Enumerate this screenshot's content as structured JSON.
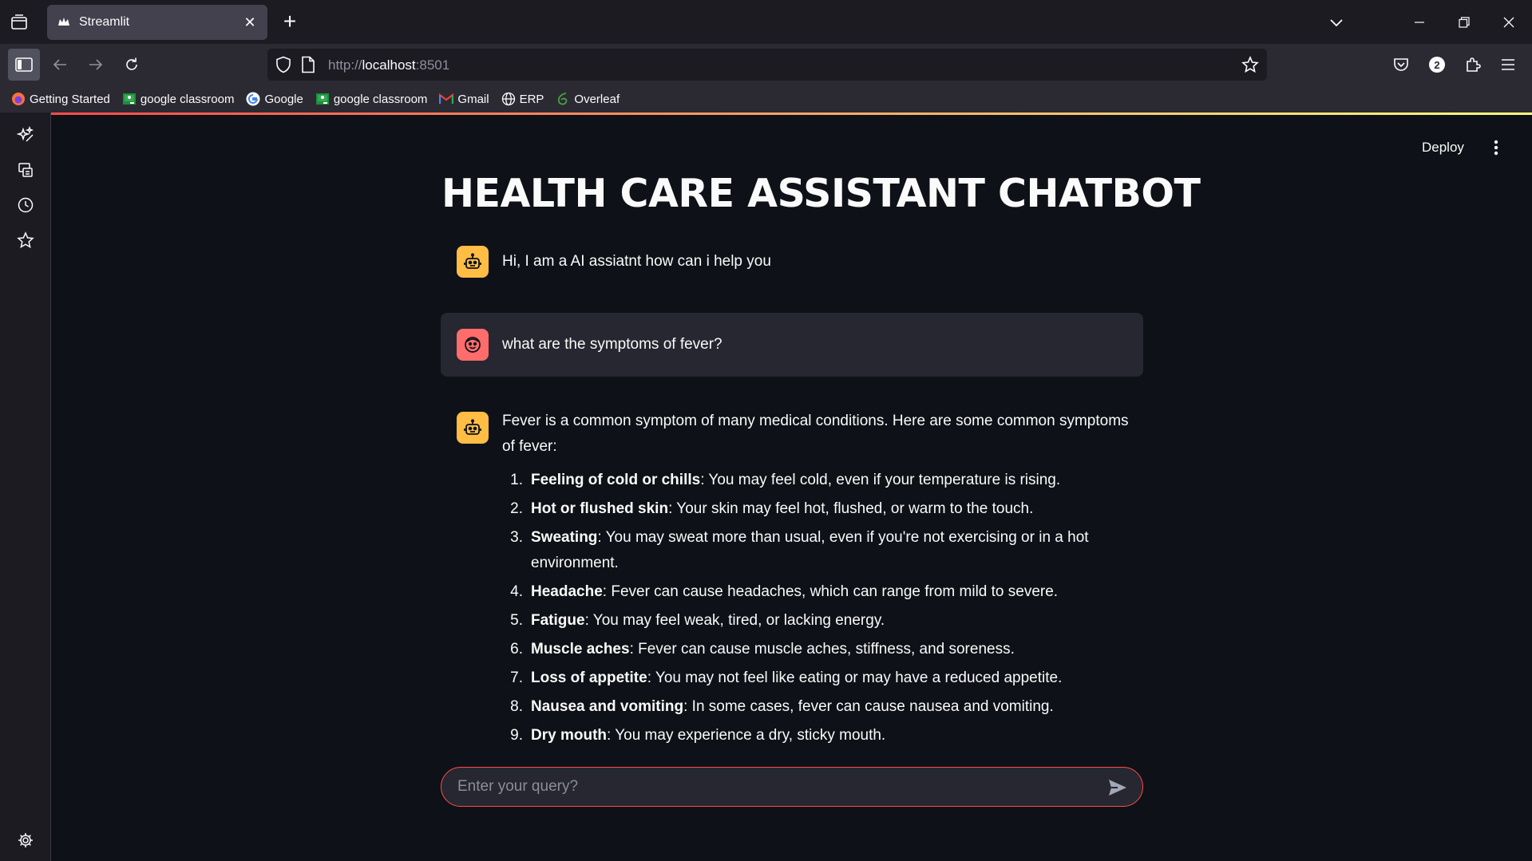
{
  "browser": {
    "tab_title": "Streamlit",
    "url_prefix": "http://",
    "url_host": "localhost",
    "url_suffix": ":8501",
    "extension_badge": "2"
  },
  "bookmarks": [
    {
      "label": "Getting Started",
      "icon": "firefox-icon"
    },
    {
      "label": "google classroom",
      "icon": "classroom-icon"
    },
    {
      "label": "Google",
      "icon": "google-icon"
    },
    {
      "label": "google classroom",
      "icon": "classroom-icon"
    },
    {
      "label": "Gmail",
      "icon": "gmail-icon"
    },
    {
      "label": "ERP",
      "icon": "globe-icon"
    },
    {
      "label": "Overleaf",
      "icon": "overleaf-icon"
    }
  ],
  "app": {
    "deploy_label": "Deploy",
    "title": "HEALTH CARE ASSISTANT CHATBOT",
    "greeting": "Hi, I am a AI assiatnt how can i help you",
    "user_question": "what are the symptoms of fever?",
    "answer_intro": "Fever is a common symptom of many medical conditions. Here are some common symptoms of fever:",
    "answer_items": [
      {
        "num": "1.",
        "term": "Feeling of cold or chills",
        "desc": ": You may feel cold, even if your temperature is rising."
      },
      {
        "num": "2.",
        "term": "Hot or flushed skin",
        "desc": ": Your skin may feel hot, flushed, or warm to the touch."
      },
      {
        "num": "3.",
        "term": "Sweating",
        "desc": ": You may sweat more than usual, even if you're not exercising or in a hot environment."
      },
      {
        "num": "4.",
        "term": "Headache",
        "desc": ": Fever can cause headaches, which can range from mild to severe."
      },
      {
        "num": "5.",
        "term": "Fatigue",
        "desc": ": You may feel weak, tired, or lacking energy."
      },
      {
        "num": "6.",
        "term": "Muscle aches",
        "desc": ": Fever can cause muscle aches, stiffness, and soreness."
      },
      {
        "num": "7.",
        "term": "Loss of appetite",
        "desc": ": You may not feel like eating or may have a reduced appetite."
      },
      {
        "num": "8.",
        "term": "Nausea and vomiting",
        "desc": ": In some cases, fever can cause nausea and vomiting."
      },
      {
        "num": "9.",
        "term": "Dry mouth",
        "desc": ": You may experience a dry, sticky mouth."
      }
    ],
    "input_placeholder": "Enter your query?"
  },
  "colors": {
    "bot_avatar": "#ffbd45",
    "user_avatar": "#ff6c6c",
    "accent": "#ff4b4b"
  }
}
